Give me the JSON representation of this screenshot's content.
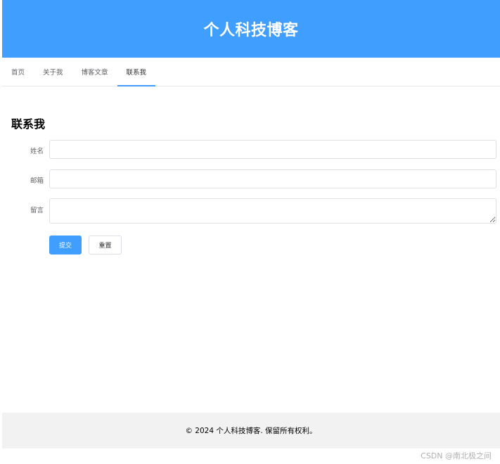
{
  "header": {
    "title": "个人科技博客"
  },
  "nav": {
    "tabs": [
      {
        "label": "首页"
      },
      {
        "label": "关于我"
      },
      {
        "label": "博客文章"
      },
      {
        "label": "联系我"
      }
    ],
    "active_index": 3
  },
  "contact": {
    "title": "联系我",
    "fields": {
      "name": {
        "label": "姓名",
        "value": ""
      },
      "email": {
        "label": "邮箱",
        "value": ""
      },
      "message": {
        "label": "留言",
        "value": ""
      }
    },
    "submit_label": "提交",
    "reset_label": "重置"
  },
  "footer": {
    "text": "© 2024 个人科技博客. 保留所有权利。"
  },
  "watermark": {
    "text": "CSDN @南北极之间"
  },
  "colors": {
    "primary": "#409eff",
    "footer_bg": "#f2f2f2",
    "border": "#dcdfe6"
  }
}
